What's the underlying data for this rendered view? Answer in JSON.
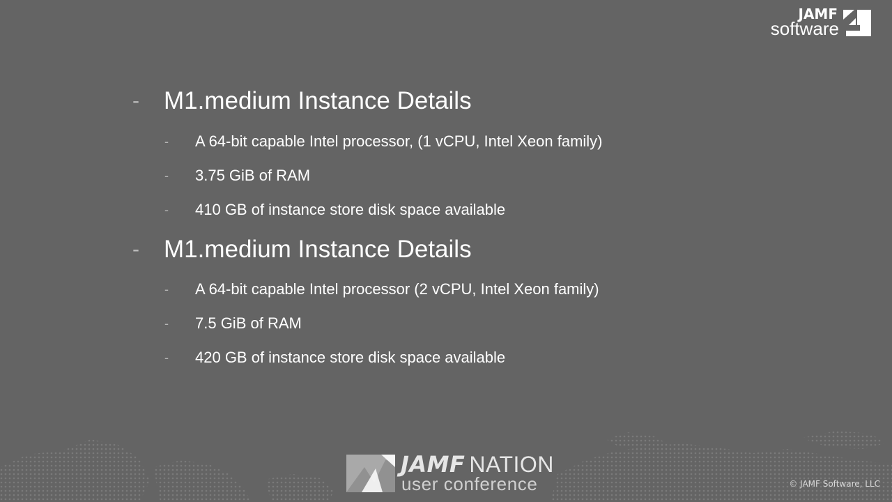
{
  "brand": {
    "top": "JAMF",
    "bottom": "software"
  },
  "sections": [
    {
      "dash": "-",
      "heading": "M1.medium Instance Details",
      "items": [
        "A 64-bit capable Intel processor, (1 vCPU, Intel Xeon family)",
        "3.75 GiB of RAM",
        "410 GB of instance store disk space available"
      ]
    },
    {
      "dash": "-",
      "heading": "M1.medium Instance Details",
      "items": [
        "A 64-bit capable Intel processor (2 vCPU, Intel Xeon family)",
        "7.5 GiB of RAM",
        "420 GB of instance store disk space available"
      ]
    }
  ],
  "footer": {
    "conference_brand": "JAMF",
    "conference_name": "NATION",
    "conference_sub": "user conference",
    "copyright": "© JAMF Software, LLC"
  },
  "colors": {
    "background": "#646464",
    "text": "#ffffff",
    "dash": "#bdbdbd"
  }
}
